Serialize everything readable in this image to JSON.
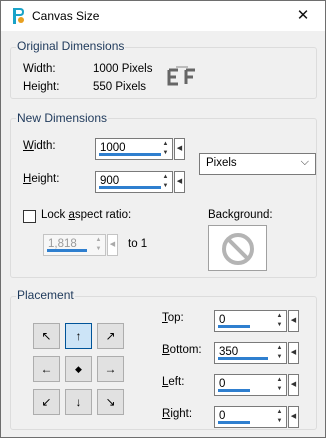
{
  "window": {
    "title": "Canvas Size",
    "close_glyph": "✕"
  },
  "original": {
    "group_title": "Original Dimensions",
    "width_label": "Width:",
    "width_value": "1000 Pixels",
    "height_label": "Height:",
    "height_value": "550 Pixels"
  },
  "new_dims": {
    "group_title": "New Dimensions",
    "width_label_u": "W",
    "width_label_rest": "idth:",
    "width_value": "1000",
    "height_label_u": "H",
    "height_label_rest": "eight:",
    "height_value": "900",
    "units": "Pixels",
    "lock_label_pre": "Lock ",
    "lock_label_u": "a",
    "lock_label_post": "spect ratio:",
    "lock_checked": false,
    "ratio_value": "1,818",
    "ratio_suffix": "to 1",
    "background_label": "Background:"
  },
  "placement": {
    "group_title": "Placement",
    "buttons": [
      "↖",
      "↑",
      "↗",
      "←",
      "◆",
      "→",
      "↙",
      "↓",
      "↘"
    ],
    "active_index": 1,
    "top_label_u": "T",
    "top_label_rest": "op:",
    "top_value": "0",
    "bottom_label_u": "B",
    "bottom_label_rest": "ottom:",
    "bottom_value": "350",
    "left_label_u": "L",
    "left_label_rest": "eft:",
    "left_value": "0",
    "right_label_u": "R",
    "right_label_rest": "ight:",
    "right_value": "0"
  },
  "colors": {
    "accent_bar": "#2f7fcf",
    "group_title": "#1e395b",
    "active_button": "#cce4f7"
  }
}
